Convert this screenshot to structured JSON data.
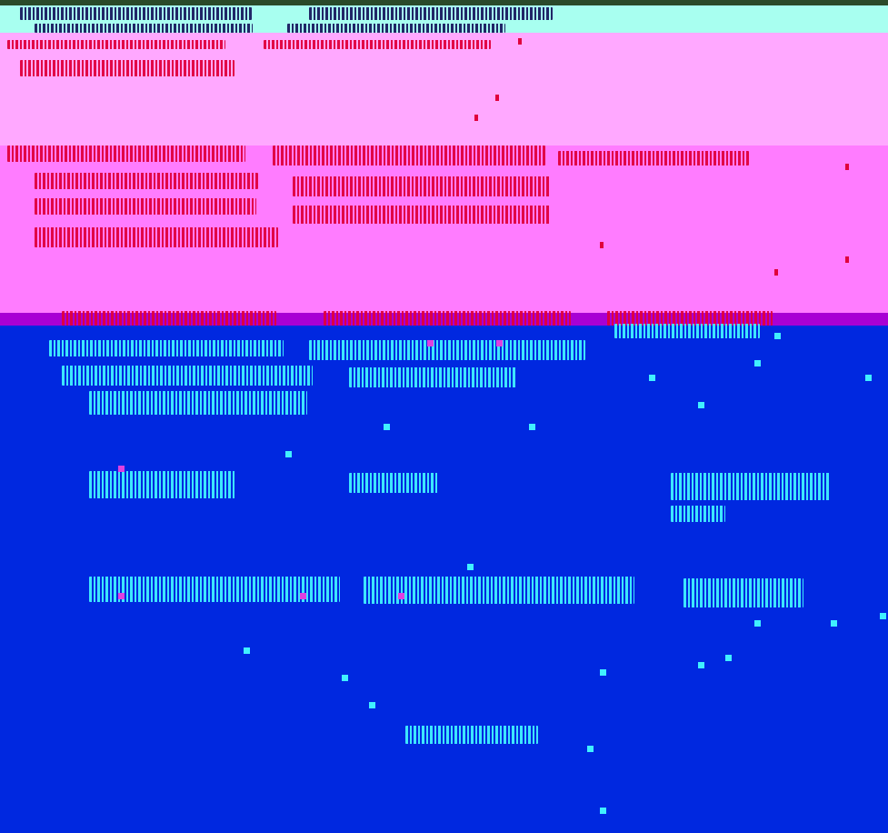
{
  "colors": {
    "top_strip": "#2a4a2a",
    "header": "#a8fff0",
    "pink": "#ffa8ff",
    "magenta": "#ff7cff",
    "purple": "#a800d4",
    "blue": "#0028e0",
    "glyph_dark": "#1a1a60",
    "glyph_red": "#e0003c",
    "glyph_cyan": "#40f0ff",
    "glyph_magenta": "#e040e0"
  }
}
